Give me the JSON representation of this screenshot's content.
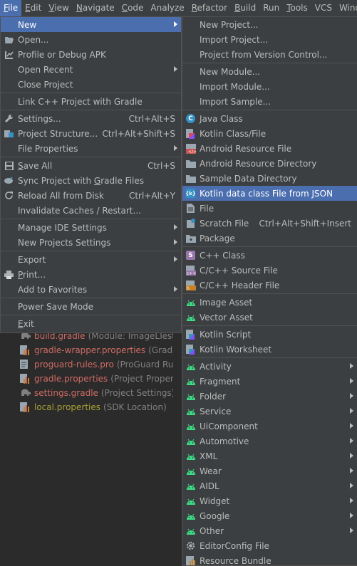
{
  "menubar": [
    {
      "label": "File",
      "mnemonic": "F",
      "rest": "ile",
      "active": true
    },
    {
      "label": "Edit",
      "mnemonic": "E",
      "rest": "dit"
    },
    {
      "label": "View",
      "mnemonic": "V",
      "rest": "iew"
    },
    {
      "label": "Navigate",
      "mnemonic": "N",
      "rest": "avigate"
    },
    {
      "label": "Code",
      "mnemonic": "C",
      "rest": "ode"
    },
    {
      "label": "Analyze",
      "mnemonic": "",
      "rest": "Analyze"
    },
    {
      "label": "Refactor",
      "mnemonic": "R",
      "rest": "efactor"
    },
    {
      "label": "Build",
      "mnemonic": "B",
      "rest": "uild"
    },
    {
      "label": "Run",
      "mnemonic": "",
      "rest": "Run"
    },
    {
      "label": "Tools",
      "mnemonic": "T",
      "rest": "ools"
    },
    {
      "label": "VCS",
      "mnemonic": "",
      "rest": "VCS"
    },
    {
      "label": "Window",
      "mnemonic": "",
      "rest": "Windo"
    }
  ],
  "file_menu": {
    "new": "New",
    "open": "Open...",
    "profile_debug_apk": "Profile or Debug APK",
    "open_recent": "Open Recent",
    "close_project": "Close Project",
    "link_cpp": "Link C++ Project with Gradle",
    "settings": "Settings...",
    "settings_shortcut": "Ctrl+Alt+S",
    "project_structure": "Project Structure...",
    "project_structure_shortcut": "Ctrl+Alt+Shift+S",
    "file_properties": "File Properties",
    "save_all": "Save All",
    "save_all_shortcut": "Ctrl+S",
    "sync_gradle": "Sync Project with Gradle Files",
    "reload_disk": "Reload All from Disk",
    "reload_disk_shortcut": "Ctrl+Alt+Y",
    "invalidate_caches": "Invalidate Caches / Restart...",
    "manage_ide": "Manage IDE Settings",
    "new_projects_settings": "New Projects Settings",
    "export": "Export",
    "print": "Print...",
    "add_favorites": "Add to Favorites",
    "power_save": "Power Save Mode",
    "exit": "Exit"
  },
  "new_menu": {
    "new_project": "New Project...",
    "import_project": "Import Project...",
    "project_from_vcs": "Project from Version Control...",
    "new_module": "New Module...",
    "import_module": "Import Module...",
    "import_sample": "Import Sample...",
    "java_class": "Java Class",
    "kotlin_class": "Kotlin Class/File",
    "android_resource_file": "Android Resource File",
    "android_resource_dir": "Android Resource Directory",
    "sample_data_dir": "Sample Data Directory",
    "kotlin_data_class_json": "Kotlin data class File from JSON",
    "file": "File",
    "scratch_file": "Scratch File",
    "scratch_file_shortcut": "Ctrl+Alt+Shift+Insert",
    "package": "Package",
    "cpp_class": "C++ Class",
    "cpp_source": "C/C++ Source File",
    "cpp_header": "C/C++ Header File",
    "image_asset": "Image Asset",
    "vector_asset": "Vector Asset",
    "kotlin_script": "Kotlin Script",
    "kotlin_worksheet": "Kotlin Worksheet",
    "activity": "Activity",
    "fragment": "Fragment",
    "folder": "Folder",
    "service": "Service",
    "ui_component": "UiComponent",
    "automotive": "Automotive",
    "xml": "XML",
    "wear": "Wear",
    "aidl": "AIDL",
    "widget": "Widget",
    "google": "Google",
    "other": "Other",
    "editorconfig": "EditorConfig File",
    "resource_bundle": "Resource Bundle"
  },
  "project_tree": [
    {
      "name": "build.gradle",
      "hint": "(Module: ImageLTest.ap",
      "color": "red",
      "icon": "gradle-elephant-icon"
    },
    {
      "name": "gradle-wrapper.properties",
      "hint": "(Gradle V",
      "color": "red",
      "icon": "properties-file-icon"
    },
    {
      "name": "proguard-rules.pro",
      "hint": "(ProGuard Rules",
      "color": "red",
      "icon": "proguard-file-icon"
    },
    {
      "name": "gradle.properties",
      "hint": "(Project Properties",
      "color": "red",
      "icon": "properties-file-icon"
    },
    {
      "name": "settings.gradle",
      "hint": "(Project Settings)",
      "color": "red",
      "icon": "gradle-elephant-icon"
    },
    {
      "name": "local.properties",
      "hint": "(SDK Location)",
      "color": "olive",
      "icon": "properties-file-icon"
    }
  ],
  "colors": {
    "selection": "#4b6eaf",
    "menu_bg": "#3c3f41",
    "android_green": "#3ddc84",
    "java_blue": "#3592c4",
    "kotlin_purple": "#7f52ff",
    "cpp_purple": "#9876aa"
  }
}
